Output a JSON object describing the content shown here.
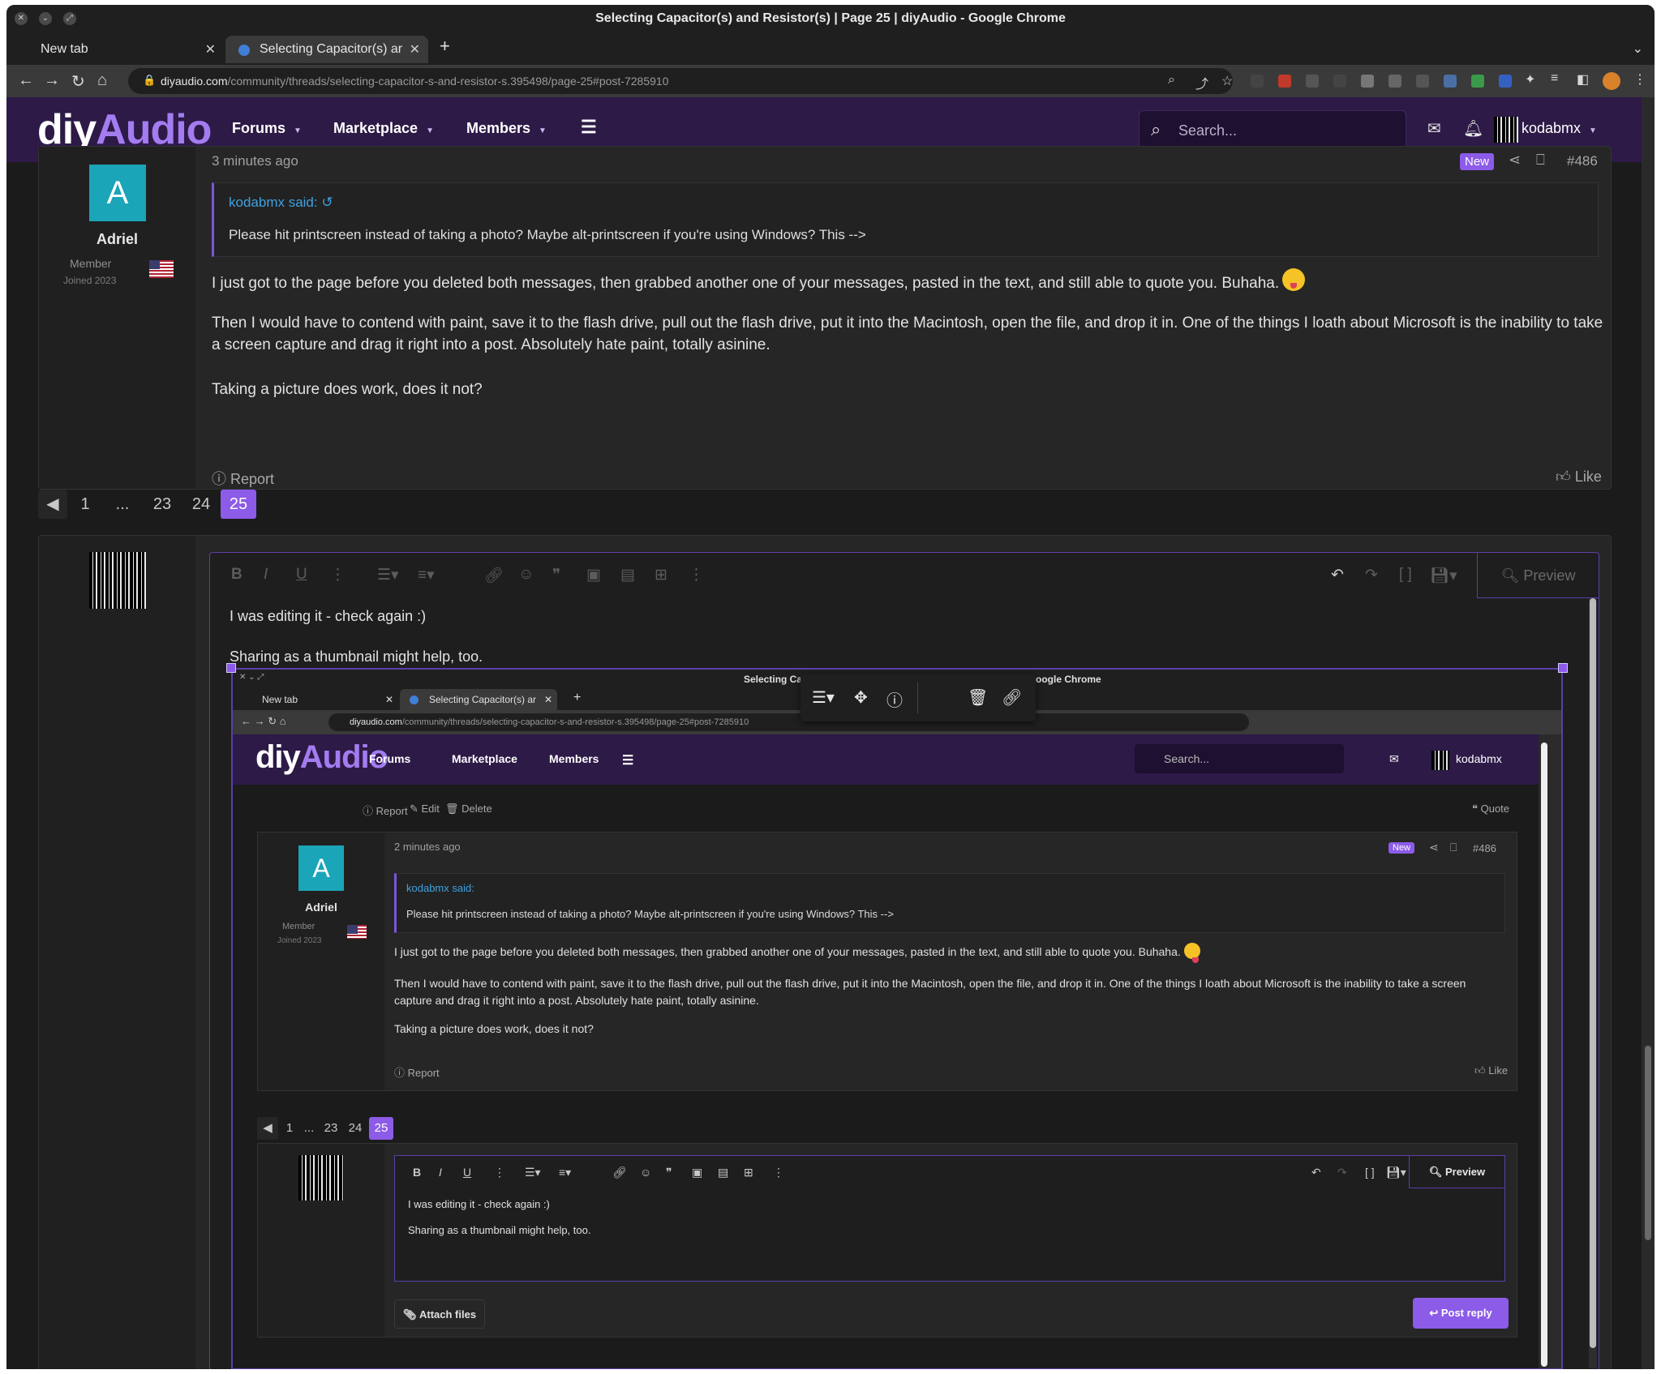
{
  "browser": {
    "window_title": "Selecting Capacitor(s) and Resistor(s) | Page 25 | diyAudio - Google Chrome",
    "tabs": [
      {
        "label": "New tab"
      },
      {
        "label": "Selecting Capacitor(s) ar"
      }
    ],
    "url_host": "diyaudio.com",
    "url_path": "/community/threads/selecting-capacitor-s-and-resistor-s.395498/page-25#post-7285910"
  },
  "site": {
    "logo_diy": "diy",
    "logo_audio": "Audio",
    "nav": [
      {
        "label": "Forums"
      },
      {
        "label": "Marketplace"
      },
      {
        "label": "Members"
      }
    ],
    "search_placeholder": "Search...",
    "username": "kodabmx"
  },
  "post": {
    "time": "3 minutes ago",
    "badge": "New",
    "number": "#486",
    "author": "Adriel",
    "avatar_letter": "A",
    "role": "Member",
    "joined": "Joined 2023",
    "quote_author": "kodabmx said:",
    "quote_text": "Please hit printscreen instead of taking a photo? Maybe alt-printscreen if you're using Windows? This -->",
    "paragraphs": [
      "I just got to the page before you deleted both messages, then grabbed another one of your messages, pasted in the text, and still able to quote you. Buhaha.",
      "Then I would have to contend with paint, save it to the flash drive, pull out the flash drive, put it into the Macintosh, open the file, and drop it in. One of the things I loath about Microsoft is the inability to take a screen capture and drag it right into a post. Absolutely hate paint, totally asinine.",
      "Taking a picture does work, does it not?"
    ],
    "report": "Report",
    "like": "Like"
  },
  "pagination": {
    "pages": [
      "1",
      "...",
      "23",
      "24",
      "25"
    ],
    "current": "25"
  },
  "editor": {
    "preview": "Preview",
    "lines": [
      "I was editing it - check again :)",
      "Sharing as a thumbnail might help, too."
    ]
  },
  "embedded": {
    "window_title_left": "Selecting Cap",
    "window_title_right": "oogle Chrome",
    "tabs": [
      {
        "label": "New tab"
      },
      {
        "label": "Selecting Capacitor(s) ar"
      }
    ],
    "url_host": "diyaudio.com",
    "url_path": "/community/threads/selecting-capacitor-s-and-resistor-s.395498/page-25#post-7285910",
    "prev_actions": {
      "report": "Report",
      "edit": "Edit",
      "delete": "Delete",
      "quote": "Quote"
    },
    "post": {
      "time": "2 minutes ago",
      "badge": "New",
      "number": "#486",
      "author": "Adriel",
      "avatar_letter": "A",
      "role": "Member",
      "joined": "Joined 2023",
      "quote_author": "kodabmx said:",
      "quote_text": "Please hit printscreen instead of taking a photo? Maybe alt-printscreen if you're using Windows? This -->",
      "paragraphs": [
        "I just got to the page before you deleted both messages, then grabbed another one of your messages, pasted in the text, and still able to quote you. Buhaha.",
        "Then I would have to contend with paint, save it to the flash drive, pull out the flash drive, put it into the Macintosh, open the file, and drop it in. One of the things I loath about Microsoft is the inability to take a screen capture and drag it right into a post. Absolutely hate paint, totally asinine.",
        "Taking a picture does work, does it not?"
      ],
      "report": "Report",
      "like": "Like"
    },
    "pages": [
      "1",
      "...",
      "23",
      "24",
      "25"
    ],
    "editor_lines": [
      "I was editing it - check again :)",
      "Sharing as a thumbnail might help, too."
    ],
    "preview": "Preview",
    "attach": "Attach files",
    "post_reply": "Post reply"
  },
  "colors": {
    "accent": "#8c5be8",
    "header_bg": "#2d1a47",
    "link": "#3fa1e0",
    "avatar": "#1aa5b8"
  }
}
